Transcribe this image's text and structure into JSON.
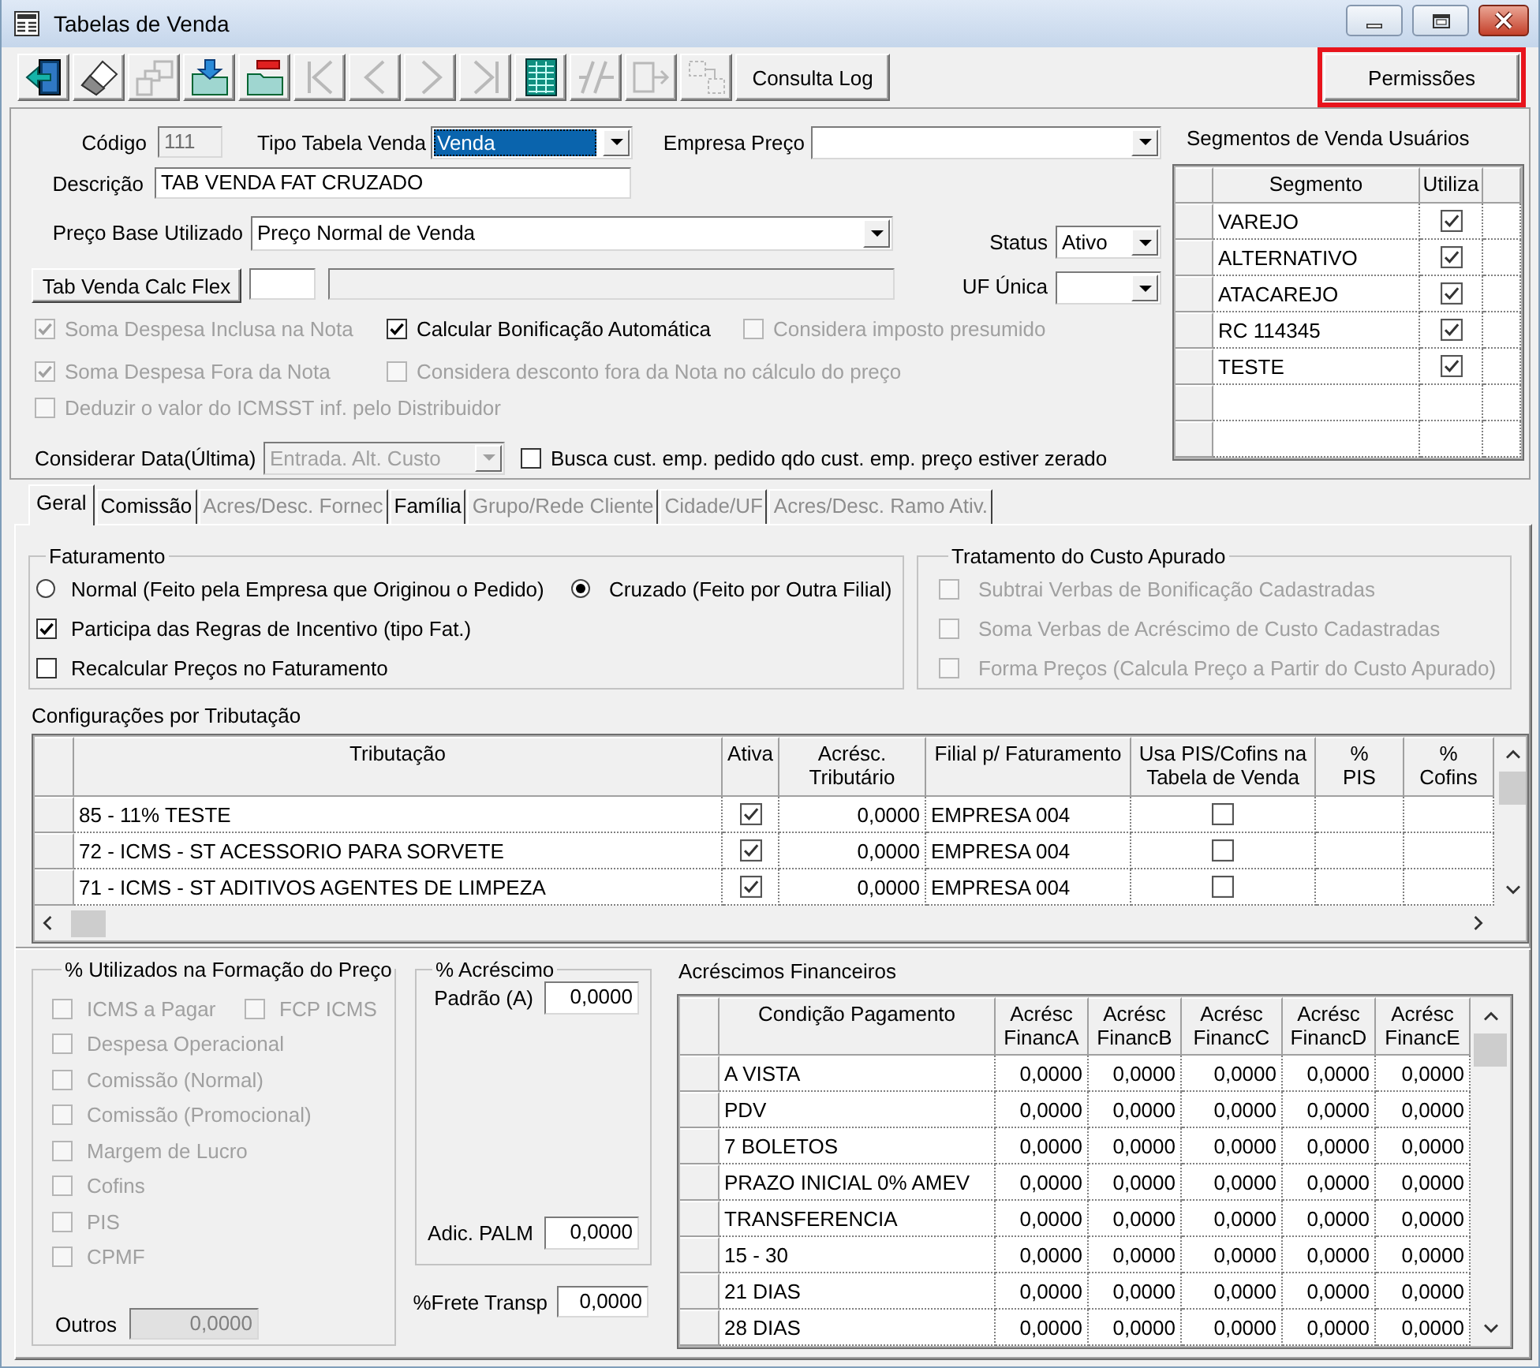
{
  "window": {
    "title": "Tabelas de Venda"
  },
  "toolbar": {
    "tools": [
      {
        "kind": "exit",
        "disabled": false
      },
      {
        "kind": "eraser",
        "disabled": false
      },
      {
        "kind": "stack",
        "disabled": true
      },
      {
        "kind": "import",
        "disabled": false
      },
      {
        "kind": "remove",
        "disabled": false
      },
      {
        "kind": "first",
        "disabled": true
      },
      {
        "kind": "previous",
        "disabled": true
      },
      {
        "kind": "next",
        "disabled": true
      },
      {
        "kind": "last",
        "disabled": true
      },
      {
        "kind": "grid",
        "disabled": false
      },
      {
        "kind": "slashes",
        "disabled": true
      },
      {
        "kind": "box-arrow",
        "disabled": true
      },
      {
        "kind": "dashed-boxes",
        "disabled": true
      }
    ],
    "log_button": {
      "label": "Consulta Log"
    },
    "permissions_button": {
      "label": "Permissões",
      "highlighted": true
    }
  },
  "form": {
    "codigo": {
      "label": "Código",
      "value": "111",
      "disabled": true
    },
    "tipo_tabela": {
      "label": "Tipo Tabela Venda",
      "value": "Venda",
      "focused": true
    },
    "empresa_preco": {
      "label": "Empresa Preço"
    },
    "descricao": {
      "label": "Descrição",
      "value": "TAB VENDA FAT CRUZADO"
    },
    "preco_base": {
      "label": "Preço Base Utilizado",
      "value": "Preço Normal de Venda"
    },
    "status": {
      "label": "Status",
      "value": "Ativo"
    },
    "calc_flex": {
      "button": "Tab Venda Calc Flex",
      "fields": [
        {
          "disabled": false
        },
        {
          "disabled": true
        }
      ]
    },
    "uf_unica": {
      "label": "UF Única"
    },
    "options": [
      {
        "items": [
          {
            "label": "Soma Despesa Inclusa na Nota",
            "checked": true,
            "disabled": true
          },
          {
            "label": "Calcular Bonificação Automática",
            "checked": true,
            "disabled": false
          },
          {
            "label": "Considera imposto presumido",
            "checked": false,
            "disabled": true
          }
        ]
      },
      {
        "items": [
          {
            "label": "Soma Despesa Fora da Nota",
            "checked": true,
            "disabled": true
          },
          {
            "label": "Considera desconto fora da Nota no cálculo do preço",
            "checked": false,
            "disabled": true
          }
        ]
      },
      {
        "items": [
          {
            "label": "Deduzir o valor do ICMSST inf. pelo Distribuidor",
            "checked": false,
            "disabled": true
          }
        ]
      }
    ],
    "considerar_data": {
      "label": "Considerar Data(Última)",
      "value": "Entrada. Alt. Custo",
      "disabled": true
    },
    "busca": {
      "label": "Busca cust. emp. pedido qdo cust. emp. preço estiver zerado",
      "checked": false,
      "disabled": false
    }
  },
  "segments": {
    "title": "Segmentos de Venda Usuários",
    "columns": [
      "Segmento",
      "Utiliza"
    ],
    "rows": [
      {
        "segmento": "VAREJO",
        "utiliza": true
      },
      {
        "segmento": "ALTERNATIVO",
        "utiliza": true
      },
      {
        "segmento": "ATACAREJO",
        "utiliza": true
      },
      {
        "segmento": "RC 114345",
        "utiliza": true
      },
      {
        "segmento": "TESTE",
        "utiliza": true
      }
    ]
  },
  "tabs": [
    {
      "label": "Geral",
      "selected": true,
      "disabled": false
    },
    {
      "label": "Comissão",
      "selected": false,
      "disabled": false
    },
    {
      "label": "Acres/Desc. Fornec",
      "selected": false,
      "disabled": true
    },
    {
      "label": "Família",
      "selected": false,
      "disabled": false
    },
    {
      "label": "Grupo/Rede Cliente",
      "selected": false,
      "disabled": true
    },
    {
      "label": "Cidade/UF",
      "selected": false,
      "disabled": true
    },
    {
      "label": "Acres/Desc. Ramo Ativ.",
      "selected": false,
      "disabled": true
    }
  ],
  "faturamento": {
    "title": "Faturamento",
    "options": [
      {
        "label": "Normal (Feito pela Empresa que Originou o Pedido)",
        "selected": false
      },
      {
        "label": "Cruzado (Feito por Outra Filial)",
        "selected": true
      }
    ],
    "checkboxes": [
      {
        "label": "Participa das Regras de Incentivo (tipo Fat.)",
        "checked": true,
        "disabled": false
      },
      {
        "label": "Recalcular Preços no Faturamento",
        "checked": false,
        "disabled": false
      }
    ]
  },
  "tratamento_custo": {
    "title": "Tratamento do Custo Apurado",
    "checkboxes": [
      {
        "label": "Subtrai Verbas de Bonificação Cadastradas",
        "checked": false,
        "disabled": true
      },
      {
        "label": "Soma Verbas de Acréscimo de Custo Cadastradas",
        "checked": false,
        "disabled": true
      },
      {
        "label": "Forma Preços (Calcula Preço a Partir do Custo Apurado)",
        "checked": false,
        "disabled": true
      }
    ]
  },
  "tributacao": {
    "title": "Configurações por Tributação",
    "columns": [
      "Tributação",
      "Ativa",
      "Acrésc. Tributário",
      "Filial p/ Faturamento",
      "Usa PIS/Cofins na Tabela de Venda",
      "% PIS",
      "% Cofins"
    ],
    "rows": [
      {
        "tributacao": "85 - 11% TESTE",
        "ativa": true,
        "acresc": "0,0000",
        "filial": "EMPRESA 004",
        "usa_pis_cofins": false
      },
      {
        "tributacao": "72 - ICMS - ST ACESSORIO PARA SORVETE",
        "ativa": true,
        "acresc": "0,0000",
        "filial": "EMPRESA 004",
        "usa_pis_cofins": false
      },
      {
        "tributacao": "71 - ICMS - ST ADITIVOS AGENTES DE LIMPEZA",
        "ativa": true,
        "acresc": "0,0000",
        "filial": "EMPRESA 004",
        "usa_pis_cofins": false
      }
    ]
  },
  "formacao_preco": {
    "title": "% Utilizados na Formação do Preço",
    "rows": [
      {
        "items": [
          {
            "label": "ICMS a Pagar",
            "checked": false,
            "disabled": true
          },
          {
            "label": "FCP ICMS",
            "checked": false,
            "disabled": true
          }
        ]
      },
      {
        "items": [
          {
            "label": "Despesa Operacional",
            "checked": false,
            "disabled": true
          }
        ]
      },
      {
        "items": [
          {
            "label": "Comissão (Normal)",
            "checked": false,
            "disabled": true
          }
        ]
      },
      {
        "items": [
          {
            "label": "Comissão (Promocional)",
            "checked": false,
            "disabled": true
          }
        ]
      },
      {
        "items": [
          {
            "label": "Margem de Lucro",
            "checked": false,
            "disabled": true
          }
        ]
      },
      {
        "items": [
          {
            "label": "Cofins",
            "checked": false,
            "disabled": true
          }
        ]
      },
      {
        "items": [
          {
            "label": "PIS",
            "checked": false,
            "disabled": true
          }
        ]
      },
      {
        "items": [
          {
            "label": "CPMF",
            "checked": false,
            "disabled": true
          }
        ]
      }
    ],
    "outros": {
      "label": "Outros",
      "value": "0,0000",
      "disabled": true
    }
  },
  "acrescimo": {
    "title": "% Acréscimo",
    "fields": [
      {
        "label": "Padrão (A)",
        "value": "0,0000"
      },
      {
        "label": "Adic. PALM",
        "value": "0,0000"
      }
    ]
  },
  "frete": {
    "label": "%Frete Transp",
    "value": "0,0000"
  },
  "acrescimos_financeiros": {
    "title": "Acréscimos Financeiros",
    "columns": [
      "Condição Pagamento",
      "Acrésc FinancA",
      "Acrésc FinancB",
      "Acrésc FinancC",
      "Acrésc FinancD",
      "Acrésc FinancE"
    ],
    "rows": [
      {
        "condicao": "A VISTA",
        "values": [
          "0,0000",
          "0,0000",
          "0,0000",
          "0,0000",
          "0,0000"
        ]
      },
      {
        "condicao": "PDV",
        "values": [
          "0,0000",
          "0,0000",
          "0,0000",
          "0,0000",
          "0,0000"
        ]
      },
      {
        "condicao": "7 BOLETOS",
        "values": [
          "0,0000",
          "0,0000",
          "0,0000",
          "0,0000",
          "0,0000"
        ]
      },
      {
        "condicao": "PRAZO INICIAL 0% AMEV",
        "values": [
          "0,0000",
          "0,0000",
          "0,0000",
          "0,0000",
          "0,0000"
        ]
      },
      {
        "condicao": "TRANSFERENCIA",
        "values": [
          "0,0000",
          "0,0000",
          "0,0000",
          "0,0000",
          "0,0000"
        ]
      },
      {
        "condicao": "15 - 30",
        "values": [
          "0,0000",
          "0,0000",
          "0,0000",
          "0,0000",
          "0,0000"
        ]
      },
      {
        "condicao": "21 DIAS",
        "values": [
          "0,0000",
          "0,0000",
          "0,0000",
          "0,0000",
          "0,0000"
        ]
      },
      {
        "condicao": "28 DIAS",
        "values": [
          "0,0000",
          "0,0000",
          "0,0000",
          "0,0000",
          "0,0000"
        ]
      }
    ]
  }
}
